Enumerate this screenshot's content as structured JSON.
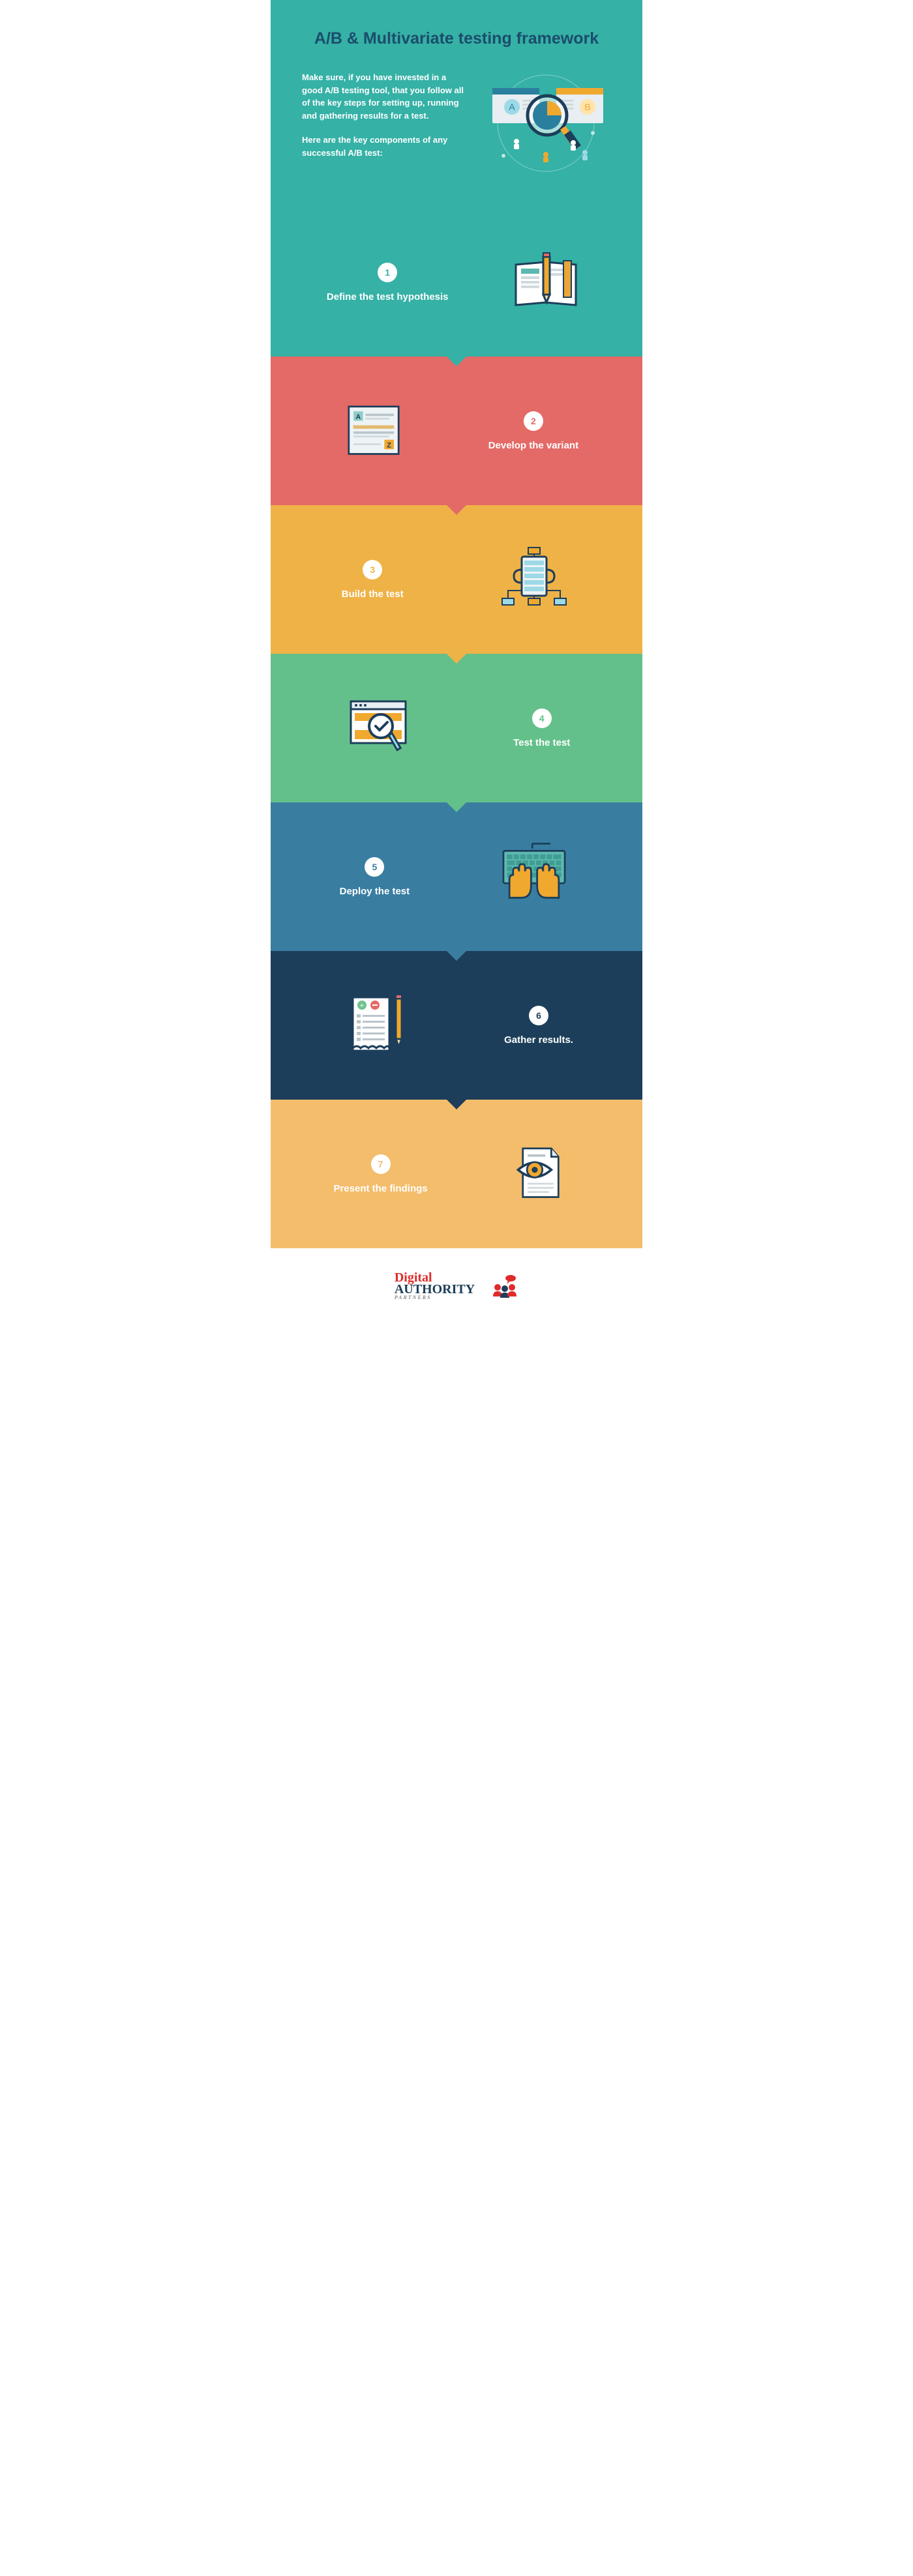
{
  "hero": {
    "title": "A/B & Multivariate testing framework",
    "p1": "Make sure, if you have invested in a good A/B testing tool, that you follow all of the key steps for setting up, running and gathering results for a test.",
    "p2": "Here are the key components of any successful A/B test:"
  },
  "steps": [
    {
      "num": "1",
      "label": "Define the test hypothesis"
    },
    {
      "num": "2",
      "label": "Develop the variant"
    },
    {
      "num": "3",
      "label": "Build the test"
    },
    {
      "num": "4",
      "label": "Test the test"
    },
    {
      "num": "5",
      "label": "Deploy the test"
    },
    {
      "num": "6",
      "label": "Gather results."
    },
    {
      "num": "7",
      "label": "Present the findings"
    }
  ],
  "footer": {
    "brand_word1": "Digital",
    "brand_word2": "AUTHORITY",
    "brand_partners": "PARTNERS"
  }
}
